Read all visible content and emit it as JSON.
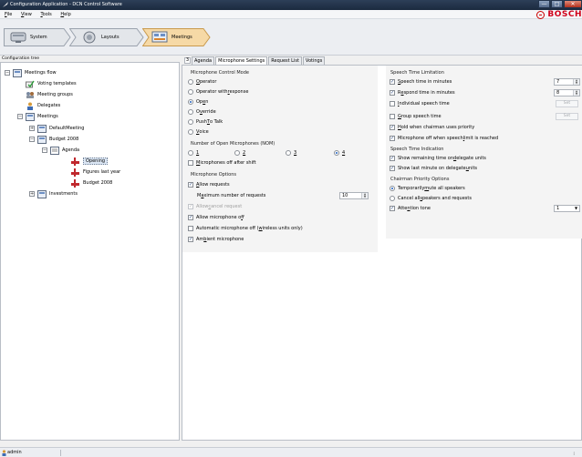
{
  "window": {
    "title": "Configuration Application - DCN Control Software",
    "buttons": {
      "minimize": "—",
      "maximize": "□",
      "close": "✕"
    }
  },
  "menu": [
    {
      "acc": "F",
      "rest": "ile"
    },
    {
      "acc": "V",
      "rest": "iew"
    },
    {
      "acc": "T",
      "rest": "ools"
    },
    {
      "acc": "H",
      "rest": "elp"
    }
  ],
  "brand": {
    "name": "BOSCH"
  },
  "nav": {
    "system": "System",
    "layouts": "Layouts",
    "meetings": "Meetings"
  },
  "tree": {
    "header": "Configuration tree",
    "items": [
      "Meetings flow",
      "Voting templates",
      "Meeting groups",
      "Delegates",
      "Meetings",
      "DefaultMeeting",
      "Budget 2008",
      "Agenda",
      "Opening",
      "Figures last year",
      "Budget 2008",
      "Investments"
    ],
    "expander_minus": "−",
    "expander_plus": "+"
  },
  "panel_number": "3",
  "tabs": [
    "Agenda",
    "Microphone Settings",
    "Request List",
    "Votings"
  ],
  "mic_control": {
    "title": "Microphone Control Mode",
    "options": [
      {
        "pre": "",
        "acc": "O",
        "post": "perator",
        "selected": false
      },
      {
        "pre": "Operator with ",
        "acc": "r",
        "post": "esponse",
        "selected": false
      },
      {
        "pre": "Op",
        "acc": "e",
        "post": "n",
        "selected": true
      },
      {
        "pre": "O",
        "acc": "v",
        "post": "erride",
        "selected": false
      },
      {
        "pre": "Push ",
        "acc": "T",
        "post": "o Talk",
        "selected": false
      },
      {
        "pre": "",
        "acc": "V",
        "post": "oice",
        "selected": false
      }
    ]
  },
  "nom": {
    "title": "Number of Open Microphones (NOM)",
    "values": [
      "1",
      "2",
      "3",
      "4"
    ],
    "selected": "4",
    "mics_off_pre": "",
    "mics_off_acc": "M",
    "mics_off_post": "icrophones off after shift",
    "mics_off_checked": false
  },
  "mic_options": {
    "title": "Microphone Options",
    "allow_requests": {
      "pre": "",
      "acc": "A",
      "post": "llow requests",
      "checked": true
    },
    "max_requests": {
      "pre": "M",
      "acc": "a",
      "post": "ximum number of requests",
      "value": "10"
    },
    "allow_cancel": {
      "pre": "Allow ",
      "acc": "c",
      "post": "ancel request",
      "checked": true,
      "disabled": true
    },
    "allow_mic_off": {
      "pre": "Allow microphone o",
      "acc": "f",
      "post": "f",
      "checked": true
    },
    "auto_mic_off": {
      "pre": "Automatic microphone off (",
      "acc": "w",
      "post": "ireless units only)",
      "checked": false
    },
    "ambient": {
      "pre": "Am",
      "acc": "b",
      "post": "ient microphone",
      "checked": true
    }
  },
  "speech_limit": {
    "title": "Speech Time Limitation",
    "speech_time": {
      "pre": "",
      "acc": "S",
      "post": "peech time in minutes",
      "checked": true,
      "value": "7"
    },
    "respond_time": {
      "pre": "R",
      "acc": "e",
      "post": "spond time in minutes",
      "checked": true,
      "value": "8"
    },
    "individual": {
      "pre": "",
      "acc": "I",
      "post": "ndividual speech time",
      "checked": false,
      "button": "Set"
    },
    "group": {
      "pre": "",
      "acc": "G",
      "post": "roup speech time",
      "checked": false,
      "button": "Set"
    },
    "hold": {
      "pre": "",
      "acc": "H",
      "post": "old when chairman uses priority",
      "checked": true
    },
    "mic_off_limit": {
      "pre": "Microphone off when speech ",
      "acc": "l",
      "post": "imit is reached",
      "checked": true
    }
  },
  "speech_indication": {
    "title": "Speech Time Indication",
    "remaining": {
      "pre": "Show remaining time on ",
      "acc": "d",
      "post": "elegate units",
      "checked": true
    },
    "last_minute": {
      "pre": "Show last minute on delegate ",
      "acc": "u",
      "post": "nits",
      "checked": true
    }
  },
  "chairman": {
    "title": "Chairman Priority Options",
    "temp_mute": {
      "pre": "Temporarily ",
      "acc": "m",
      "post": "ute all speakers",
      "selected": true
    },
    "cancel_all": {
      "pre": "Cancel all ",
      "acc": "s",
      "post": "peakers and requests",
      "selected": false
    },
    "attention": {
      "pre": "Atte",
      "acc": "n",
      "post": "tion tone",
      "checked": true,
      "value": "1"
    }
  },
  "status": {
    "user": "admin"
  },
  "glyphs": {
    "check": "✓",
    "spin_up": "▲",
    "spin_down": "▼",
    "dropdown": "▼"
  }
}
